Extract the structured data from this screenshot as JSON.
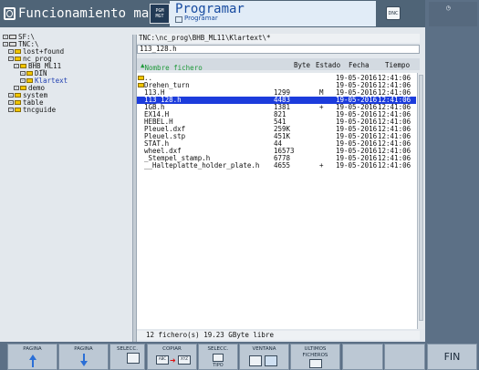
{
  "header": {
    "mode_left": "Funcionamiento man...",
    "badge_text": "PGM MGT",
    "prog_title": "Programar",
    "prog_subtitle": "Programar",
    "dnc_label": "DNC"
  },
  "tree": {
    "items": [
      {
        "label": "SF:\\",
        "kind": "drive"
      },
      {
        "label": "TNC:\\",
        "kind": "drive"
      },
      {
        "label": "lost+found",
        "kind": "folder"
      },
      {
        "label": "nc_prog",
        "kind": "folder"
      },
      {
        "label": "BHB_ML11",
        "kind": "folder"
      },
      {
        "label": "DIN",
        "kind": "folder"
      },
      {
        "label": "Klartext",
        "kind": "folder",
        "selected": true
      },
      {
        "label": "demo",
        "kind": "folder"
      },
      {
        "label": "system",
        "kind": "folder"
      },
      {
        "label": "table",
        "kind": "folder"
      },
      {
        "label": "tncguide",
        "kind": "folder"
      }
    ]
  },
  "path": "TNC:\\nc_prog\\BHB_ML11\\Klartext\\*",
  "current_file": "113_128.h",
  "columns": {
    "name": "Nombre fichero",
    "size": "Byte",
    "status": "Estado",
    "date": "Fecha",
    "time": "Tiempo"
  },
  "files": [
    {
      "name": "..",
      "size": "",
      "status": "",
      "date": "19-05-2016",
      "time": "12:41:06",
      "folder": true
    },
    {
      "name": "Drehen_turn",
      "size": "",
      "status": "",
      "date": "19-05-2016",
      "time": "12:41:06",
      "folder": true
    },
    {
      "name": "113.H",
      "size": "1299",
      "status": "M",
      "date": "19-05-2016",
      "time": "12:41:06"
    },
    {
      "name": "113_128.h",
      "size": "4483",
      "status": "",
      "date": "19-05-2016",
      "time": "12:41:06",
      "selected": true
    },
    {
      "name": "1GB.h",
      "size": "1381",
      "status": "+",
      "date": "19-05-2016",
      "time": "12:41:06"
    },
    {
      "name": "EX14.H",
      "size": "821",
      "status": "",
      "date": "19-05-2016",
      "time": "12:41:06"
    },
    {
      "name": "HEBEL.H",
      "size": "541",
      "status": "",
      "date": "19-05-2016",
      "time": "12:41:06"
    },
    {
      "name": "Pleuel.dxf",
      "size": "259K",
      "status": "",
      "date": "19-05-2016",
      "time": "12:41:06"
    },
    {
      "name": "Pleuel.stp",
      "size": "451K",
      "status": "",
      "date": "19-05-2016",
      "time": "12:41:06"
    },
    {
      "name": "STAT.h",
      "size": "44",
      "status": "",
      "date": "19-05-2016",
      "time": "12:41:06"
    },
    {
      "name": "wheel.dxf",
      "size": "16573",
      "status": "",
      "date": "19-05-2016",
      "time": "12:41:06"
    },
    {
      "name": "_Stempel_stamp.h",
      "size": "6778",
      "status": "",
      "date": "19-05-2016",
      "time": "12:41:06"
    },
    {
      "name": "__Halteplatte_holder_plate.h",
      "size": "4655",
      "status": "+",
      "date": "19-05-2016",
      "time": "12:41:06"
    }
  ],
  "status_line": "12  fichero(s)  19.23 GByte libre",
  "softkeys": {
    "pagina_up": "PAGINA",
    "pagina_down": "PAGINA",
    "selecc": "SELECC.",
    "copiar": "COPIAR",
    "copiar_from": "ABC",
    "copiar_to": "XYZ",
    "selecc_tipo": "SELECC.",
    "tipo": "TIPO",
    "ventana": "VENTANA",
    "ultimos": "ULTIMOS",
    "ficheros": "FICHEROS",
    "fin": "FIN"
  },
  "colors": {
    "header_bg": "#4f6477",
    "selection": "#1c3cdc",
    "program_title": "#174ba0"
  }
}
